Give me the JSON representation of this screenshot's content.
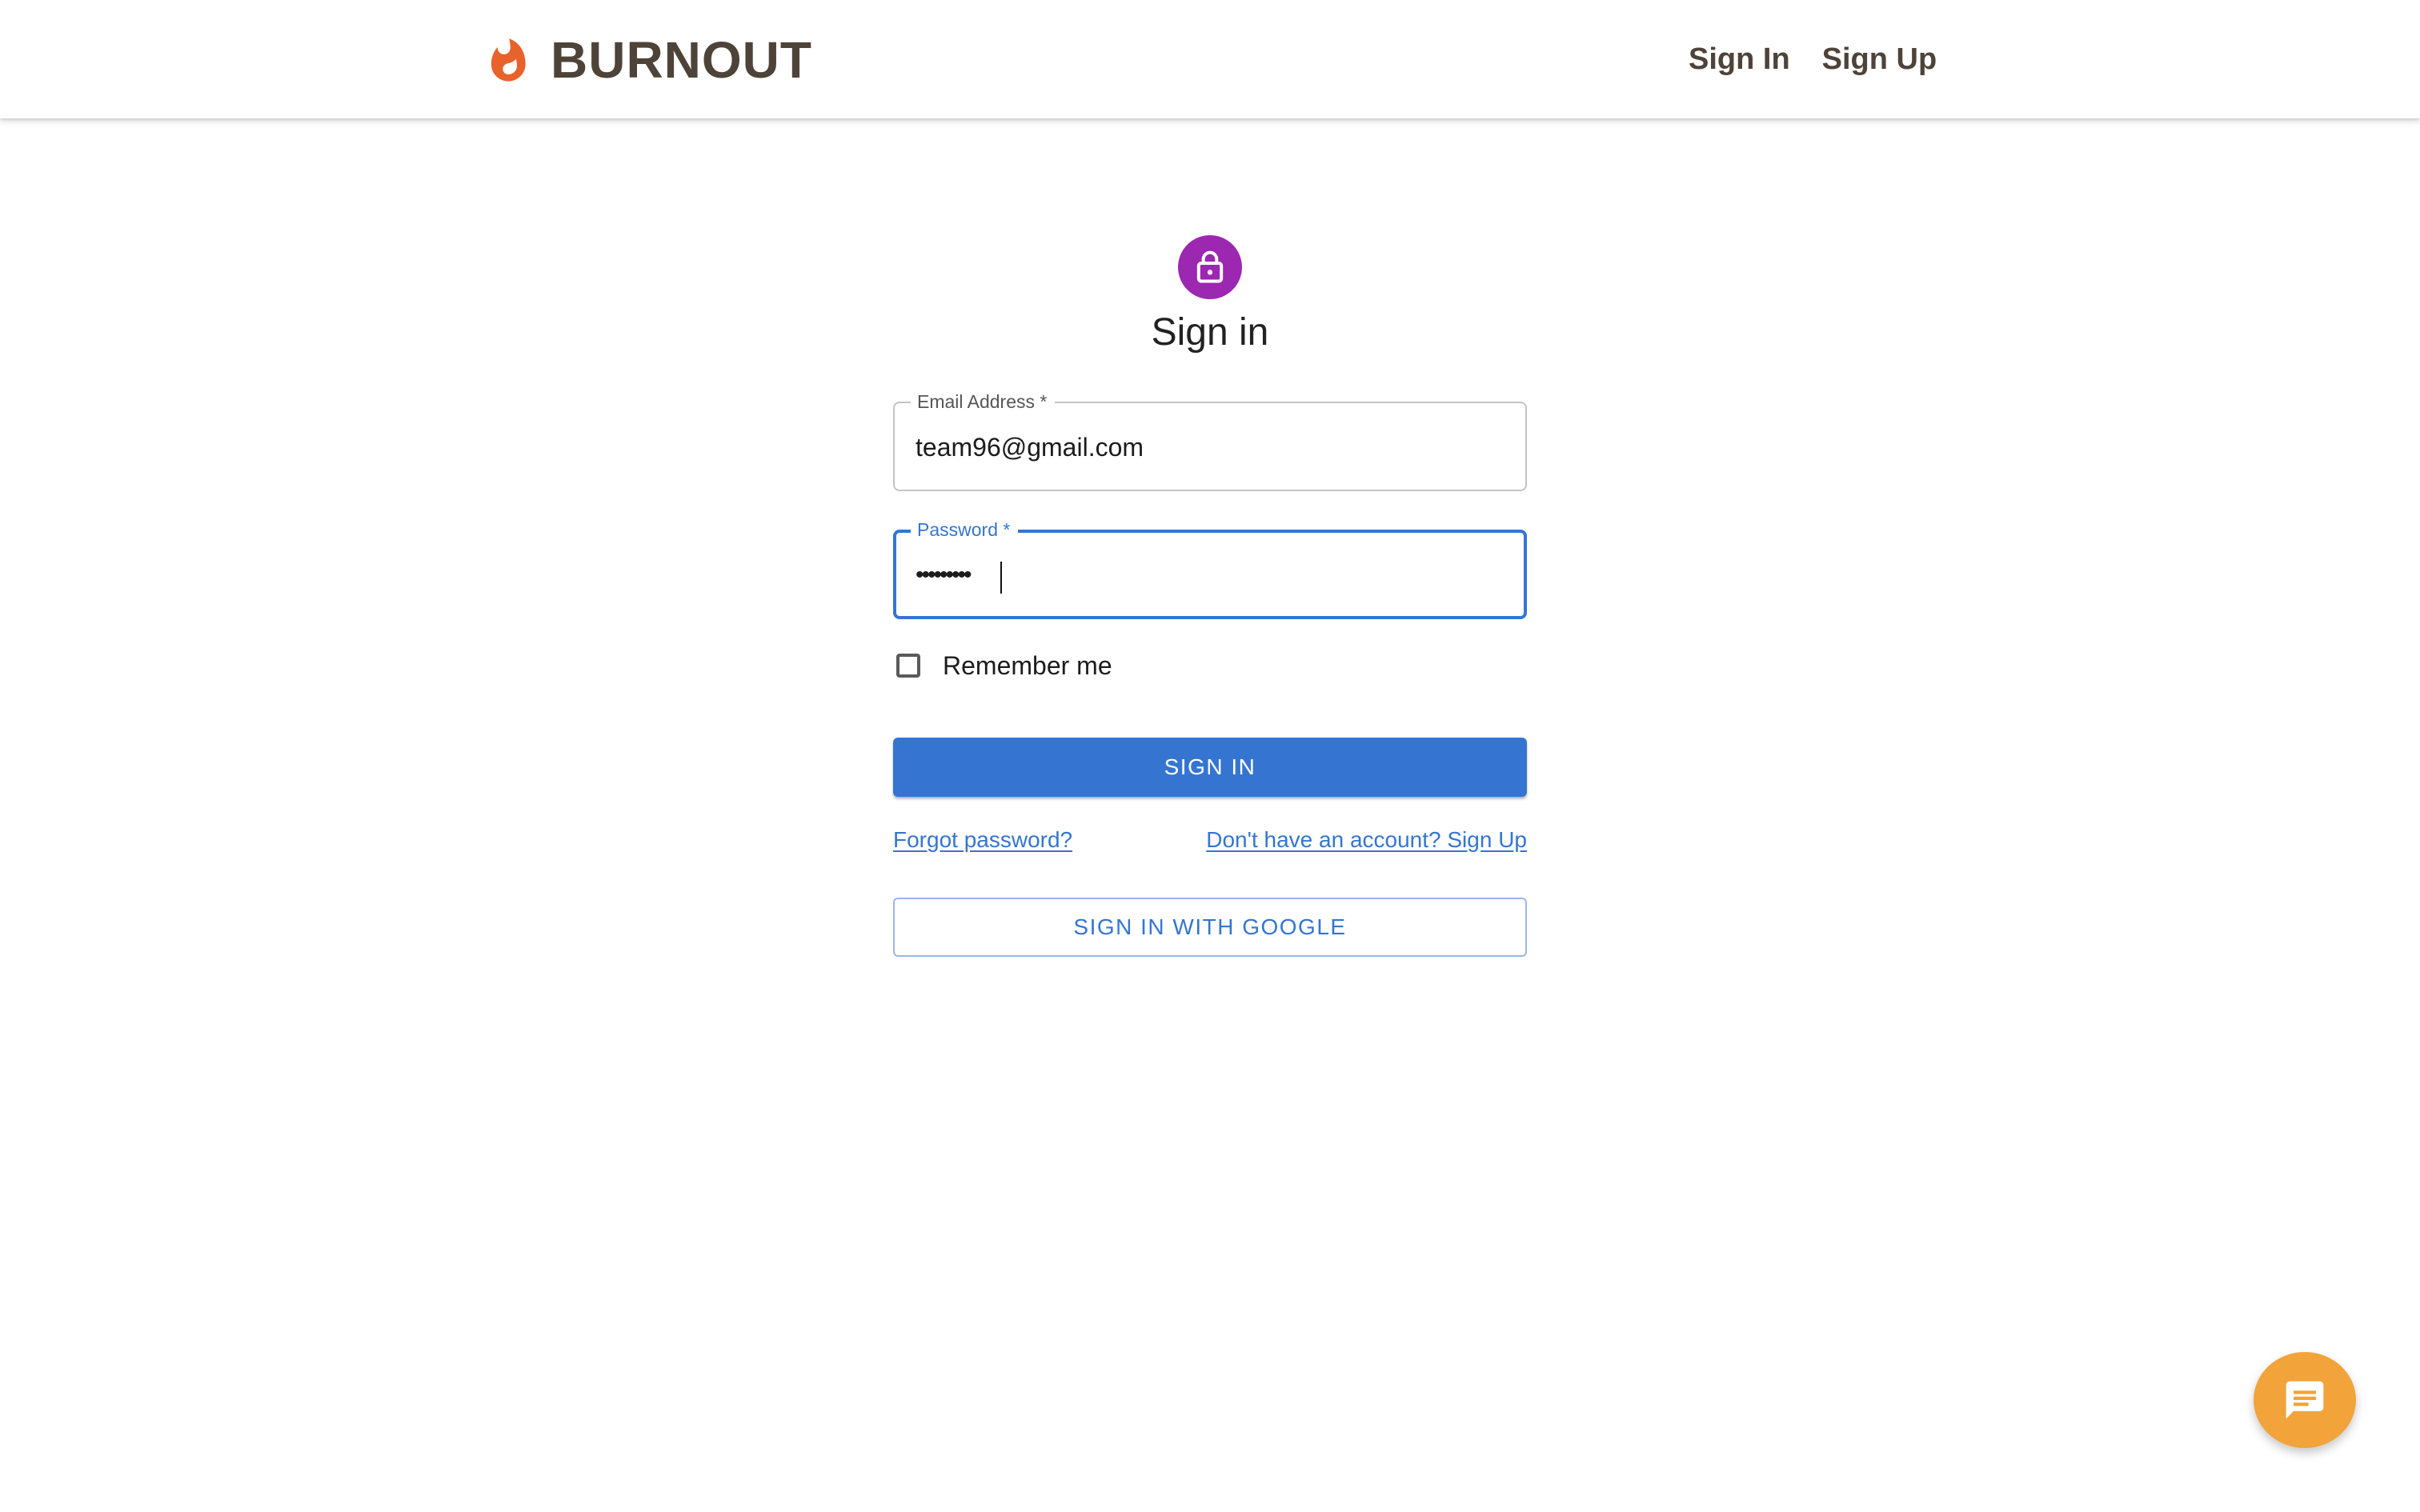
{
  "header": {
    "brand_name": "BURNOUT",
    "brand_icon": "flame-icon",
    "nav": {
      "sign_in": "Sign In",
      "sign_up": "Sign Up"
    }
  },
  "form": {
    "avatar_icon": "lock-icon",
    "title": "Sign in",
    "email": {
      "label": "Email Address *",
      "value": "team96@gmail.com"
    },
    "password": {
      "label": "Password *",
      "masked_value": "•••••••••"
    },
    "remember_label": "Remember me",
    "remember_checked": false,
    "submit_label": "SIGN IN",
    "forgot_label": "Forgot password?",
    "signup_label": "Don't have an account? Sign Up",
    "google_label": "SIGN IN WITH GOOGLE"
  },
  "chat": {
    "icon": "chat-icon"
  },
  "colors": {
    "brand_text": "#4e4339",
    "flame": "#e8622c",
    "primary": "#3575d1",
    "avatar": "#9c27b0",
    "chat_fab": "#f2a33a"
  }
}
